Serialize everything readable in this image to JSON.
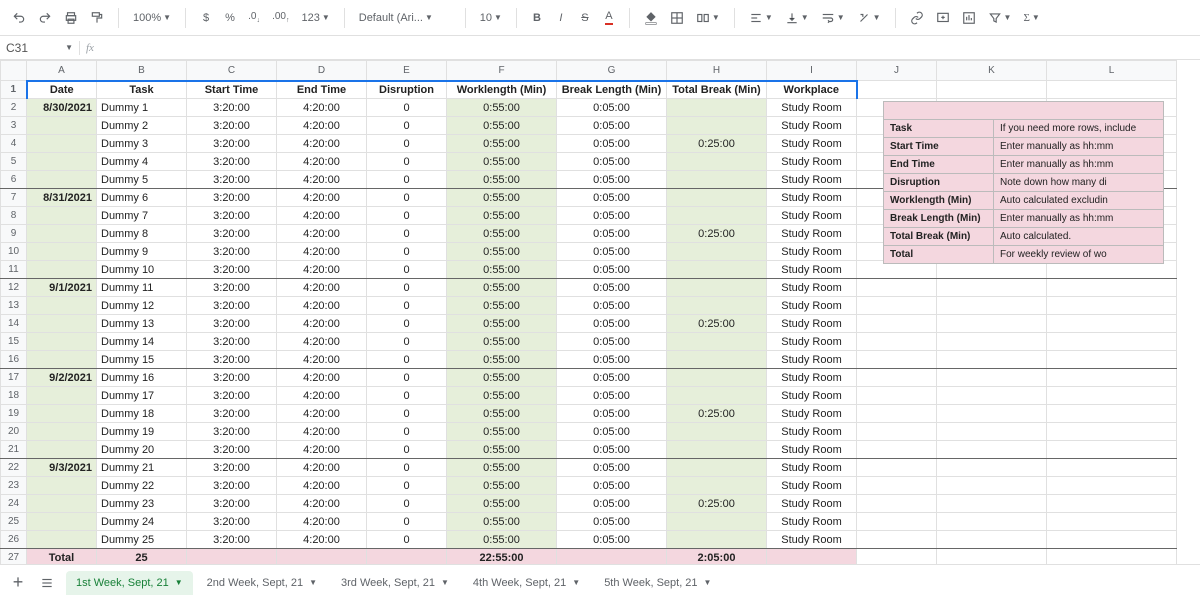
{
  "toolbar": {
    "zoom": "100%",
    "font": "Default (Ari...",
    "size": "10"
  },
  "namebox": {
    "ref": "C31",
    "fx": "fx"
  },
  "cols": [
    "A",
    "B",
    "C",
    "D",
    "E",
    "F",
    "G",
    "H",
    "I",
    "J",
    "K",
    "L"
  ],
  "headers": [
    "Date",
    "Task",
    "Start Time",
    "End Time",
    "Disruption",
    "Worklength (Min)",
    "Break Length (Min)",
    "Total Break (Min)",
    "Workplace"
  ],
  "rows": [
    {
      "n": 2,
      "date": "8/30/2021",
      "task": "Dummy 1",
      "start": "3:20:00",
      "end": "4:20:00",
      "dis": "0",
      "wl": "0:55:00",
      "bl": "0:05:00",
      "tb": "",
      "wp": "Study Room",
      "dateCell": true,
      "thick": false
    },
    {
      "n": 3,
      "date": "",
      "task": "Dummy 2",
      "start": "3:20:00",
      "end": "4:20:00",
      "dis": "0",
      "wl": "0:55:00",
      "bl": "0:05:00",
      "tb": "",
      "wp": "Study Room"
    },
    {
      "n": 4,
      "date": "",
      "task": "Dummy 3",
      "start": "3:20:00",
      "end": "4:20:00",
      "dis": "0",
      "wl": "0:55:00",
      "bl": "0:05:00",
      "tb": "0:25:00",
      "wp": "Study Room"
    },
    {
      "n": 5,
      "date": "",
      "task": "Dummy 4",
      "start": "3:20:00",
      "end": "4:20:00",
      "dis": "0",
      "wl": "0:55:00",
      "bl": "0:05:00",
      "tb": "",
      "wp": "Study Room"
    },
    {
      "n": 6,
      "date": "",
      "task": "Dummy 5",
      "start": "3:20:00",
      "end": "4:20:00",
      "dis": "0",
      "wl": "0:55:00",
      "bl": "0:05:00",
      "tb": "",
      "wp": "Study Room",
      "thick": true
    },
    {
      "n": 7,
      "date": "8/31/2021",
      "task": "Dummy 6",
      "start": "3:20:00",
      "end": "4:20:00",
      "dis": "0",
      "wl": "0:55:00",
      "bl": "0:05:00",
      "tb": "",
      "wp": "Study Room",
      "dateCell": true
    },
    {
      "n": 8,
      "date": "",
      "task": "Dummy 7",
      "start": "3:20:00",
      "end": "4:20:00",
      "dis": "0",
      "wl": "0:55:00",
      "bl": "0:05:00",
      "tb": "",
      "wp": "Study Room"
    },
    {
      "n": 9,
      "date": "",
      "task": "Dummy 8",
      "start": "3:20:00",
      "end": "4:20:00",
      "dis": "0",
      "wl": "0:55:00",
      "bl": "0:05:00",
      "tb": "0:25:00",
      "wp": "Study Room"
    },
    {
      "n": 10,
      "date": "",
      "task": "Dummy 9",
      "start": "3:20:00",
      "end": "4:20:00",
      "dis": "0",
      "wl": "0:55:00",
      "bl": "0:05:00",
      "tb": "",
      "wp": "Study Room"
    },
    {
      "n": 11,
      "date": "",
      "task": "Dummy 10",
      "start": "3:20:00",
      "end": "4:20:00",
      "dis": "0",
      "wl": "0:55:00",
      "bl": "0:05:00",
      "tb": "",
      "wp": "Study Room",
      "thick": true
    },
    {
      "n": 12,
      "date": "9/1/2021",
      "task": "Dummy 11",
      "start": "3:20:00",
      "end": "4:20:00",
      "dis": "0",
      "wl": "0:55:00",
      "bl": "0:05:00",
      "tb": "",
      "wp": "Study Room",
      "dateCell": true
    },
    {
      "n": 13,
      "date": "",
      "task": "Dummy 12",
      "start": "3:20:00",
      "end": "4:20:00",
      "dis": "0",
      "wl": "0:55:00",
      "bl": "0:05:00",
      "tb": "",
      "wp": "Study Room"
    },
    {
      "n": 14,
      "date": "",
      "task": "Dummy 13",
      "start": "3:20:00",
      "end": "4:20:00",
      "dis": "0",
      "wl": "0:55:00",
      "bl": "0:05:00",
      "tb": "0:25:00",
      "wp": "Study Room"
    },
    {
      "n": 15,
      "date": "",
      "task": "Dummy 14",
      "start": "3:20:00",
      "end": "4:20:00",
      "dis": "0",
      "wl": "0:55:00",
      "bl": "0:05:00",
      "tb": "",
      "wp": "Study Room"
    },
    {
      "n": 16,
      "date": "",
      "task": "Dummy 15",
      "start": "3:20:00",
      "end": "4:20:00",
      "dis": "0",
      "wl": "0:55:00",
      "bl": "0:05:00",
      "tb": "",
      "wp": "Study Room",
      "thick": true
    },
    {
      "n": 17,
      "date": "9/2/2021",
      "task": "Dummy 16",
      "start": "3:20:00",
      "end": "4:20:00",
      "dis": "0",
      "wl": "0:55:00",
      "bl": "0:05:00",
      "tb": "",
      "wp": "Study Room",
      "dateCell": true
    },
    {
      "n": 18,
      "date": "",
      "task": "Dummy 17",
      "start": "3:20:00",
      "end": "4:20:00",
      "dis": "0",
      "wl": "0:55:00",
      "bl": "0:05:00",
      "tb": "",
      "wp": "Study Room"
    },
    {
      "n": 19,
      "date": "",
      "task": "Dummy 18",
      "start": "3:20:00",
      "end": "4:20:00",
      "dis": "0",
      "wl": "0:55:00",
      "bl": "0:05:00",
      "tb": "0:25:00",
      "wp": "Study Room"
    },
    {
      "n": 20,
      "date": "",
      "task": "Dummy 19",
      "start": "3:20:00",
      "end": "4:20:00",
      "dis": "0",
      "wl": "0:55:00",
      "bl": "0:05:00",
      "tb": "",
      "wp": "Study Room"
    },
    {
      "n": 21,
      "date": "",
      "task": "Dummy 20",
      "start": "3:20:00",
      "end": "4:20:00",
      "dis": "0",
      "wl": "0:55:00",
      "bl": "0:05:00",
      "tb": "",
      "wp": "Study Room",
      "thick": true
    },
    {
      "n": 22,
      "date": "9/3/2021",
      "task": "Dummy 21",
      "start": "3:20:00",
      "end": "4:20:00",
      "dis": "0",
      "wl": "0:55:00",
      "bl": "0:05:00",
      "tb": "",
      "wp": "Study Room",
      "dateCell": true
    },
    {
      "n": 23,
      "date": "",
      "task": "Dummy 22",
      "start": "3:20:00",
      "end": "4:20:00",
      "dis": "0",
      "wl": "0:55:00",
      "bl": "0:05:00",
      "tb": "",
      "wp": "Study Room"
    },
    {
      "n": 24,
      "date": "",
      "task": "Dummy 23",
      "start": "3:20:00",
      "end": "4:20:00",
      "dis": "0",
      "wl": "0:55:00",
      "bl": "0:05:00",
      "tb": "0:25:00",
      "wp": "Study Room"
    },
    {
      "n": 25,
      "date": "",
      "task": "Dummy 24",
      "start": "3:20:00",
      "end": "4:20:00",
      "dis": "0",
      "wl": "0:55:00",
      "bl": "0:05:00",
      "tb": "",
      "wp": "Study Room"
    },
    {
      "n": 26,
      "date": "",
      "task": "Dummy 25",
      "start": "3:20:00",
      "end": "4:20:00",
      "dis": "0",
      "wl": "0:55:00",
      "bl": "0:05:00",
      "tb": "",
      "wp": "Study Room",
      "thick": true
    }
  ],
  "totals": {
    "n": 27,
    "label": "Total",
    "b": "25",
    "f": "22:55:00",
    "h": "2:05:00"
  },
  "legend": [
    {
      "l": "Task",
      "r": "If you need more rows, include"
    },
    {
      "l": "Start Time",
      "r": "Enter manually as hh:mm"
    },
    {
      "l": "End Time",
      "r": "Enter manually as hh:mm"
    },
    {
      "l": "Disruption",
      "r": "Note down how many di"
    },
    {
      "l": "Worklength (Min)",
      "r": "Auto calculated excludin"
    },
    {
      "l": "Break Length (Min)",
      "r": "Enter manually as hh:mm"
    },
    {
      "l": "Total Break (Min)",
      "r": "Auto calculated."
    },
    {
      "l": "Total",
      "r": "For weekly review of wo"
    }
  ],
  "sheets": [
    "1st Week, Sept, 21",
    "2nd Week, Sept, 21",
    "3rd Week, Sept, 21",
    "4th Week, Sept, 21",
    "5th Week, Sept, 21"
  ],
  "activeSheet": 0,
  "icons": {
    "undo": "↶",
    "redo": "↷",
    "print": "⎙",
    "paint": "🖉",
    "dollar": "$",
    "percent": "%",
    "dec0": ".0",
    "dec00": ".00",
    "num": "123",
    "bold": "B",
    "italic": "I",
    "strike": "S",
    "fill": "◧",
    "borders": "▦",
    "merge": "▥",
    "link": "🔗",
    "comment": "⊞",
    "chart": "▥",
    "filter": "▽",
    "sigma": "Σ"
  }
}
